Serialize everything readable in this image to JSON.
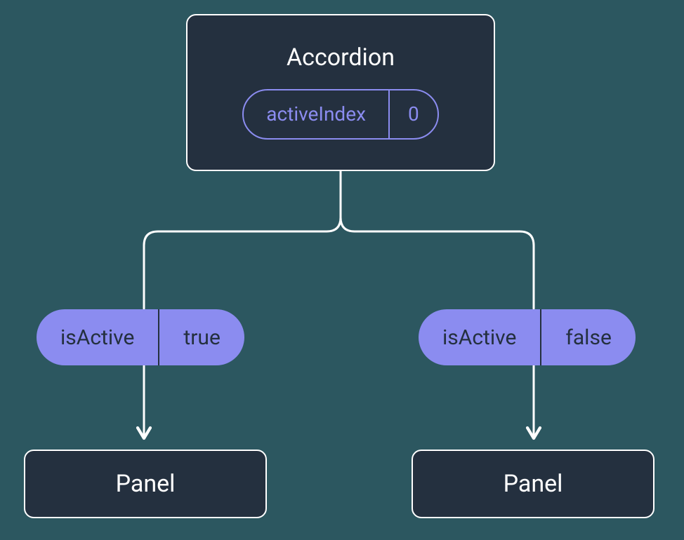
{
  "accordion": {
    "title": "Accordion",
    "state": {
      "label": "activeIndex",
      "value": "0"
    }
  },
  "props": {
    "left": {
      "label": "isActive",
      "value": "true"
    },
    "right": {
      "label": "isActive",
      "value": "false"
    }
  },
  "panels": {
    "left": {
      "label": "Panel"
    },
    "right": {
      "label": "Panel"
    }
  },
  "colors": {
    "node_bg": "#24303f",
    "stroke": "#ffffff",
    "accent": "#8b8cf0",
    "prop_text": "#24303f"
  }
}
